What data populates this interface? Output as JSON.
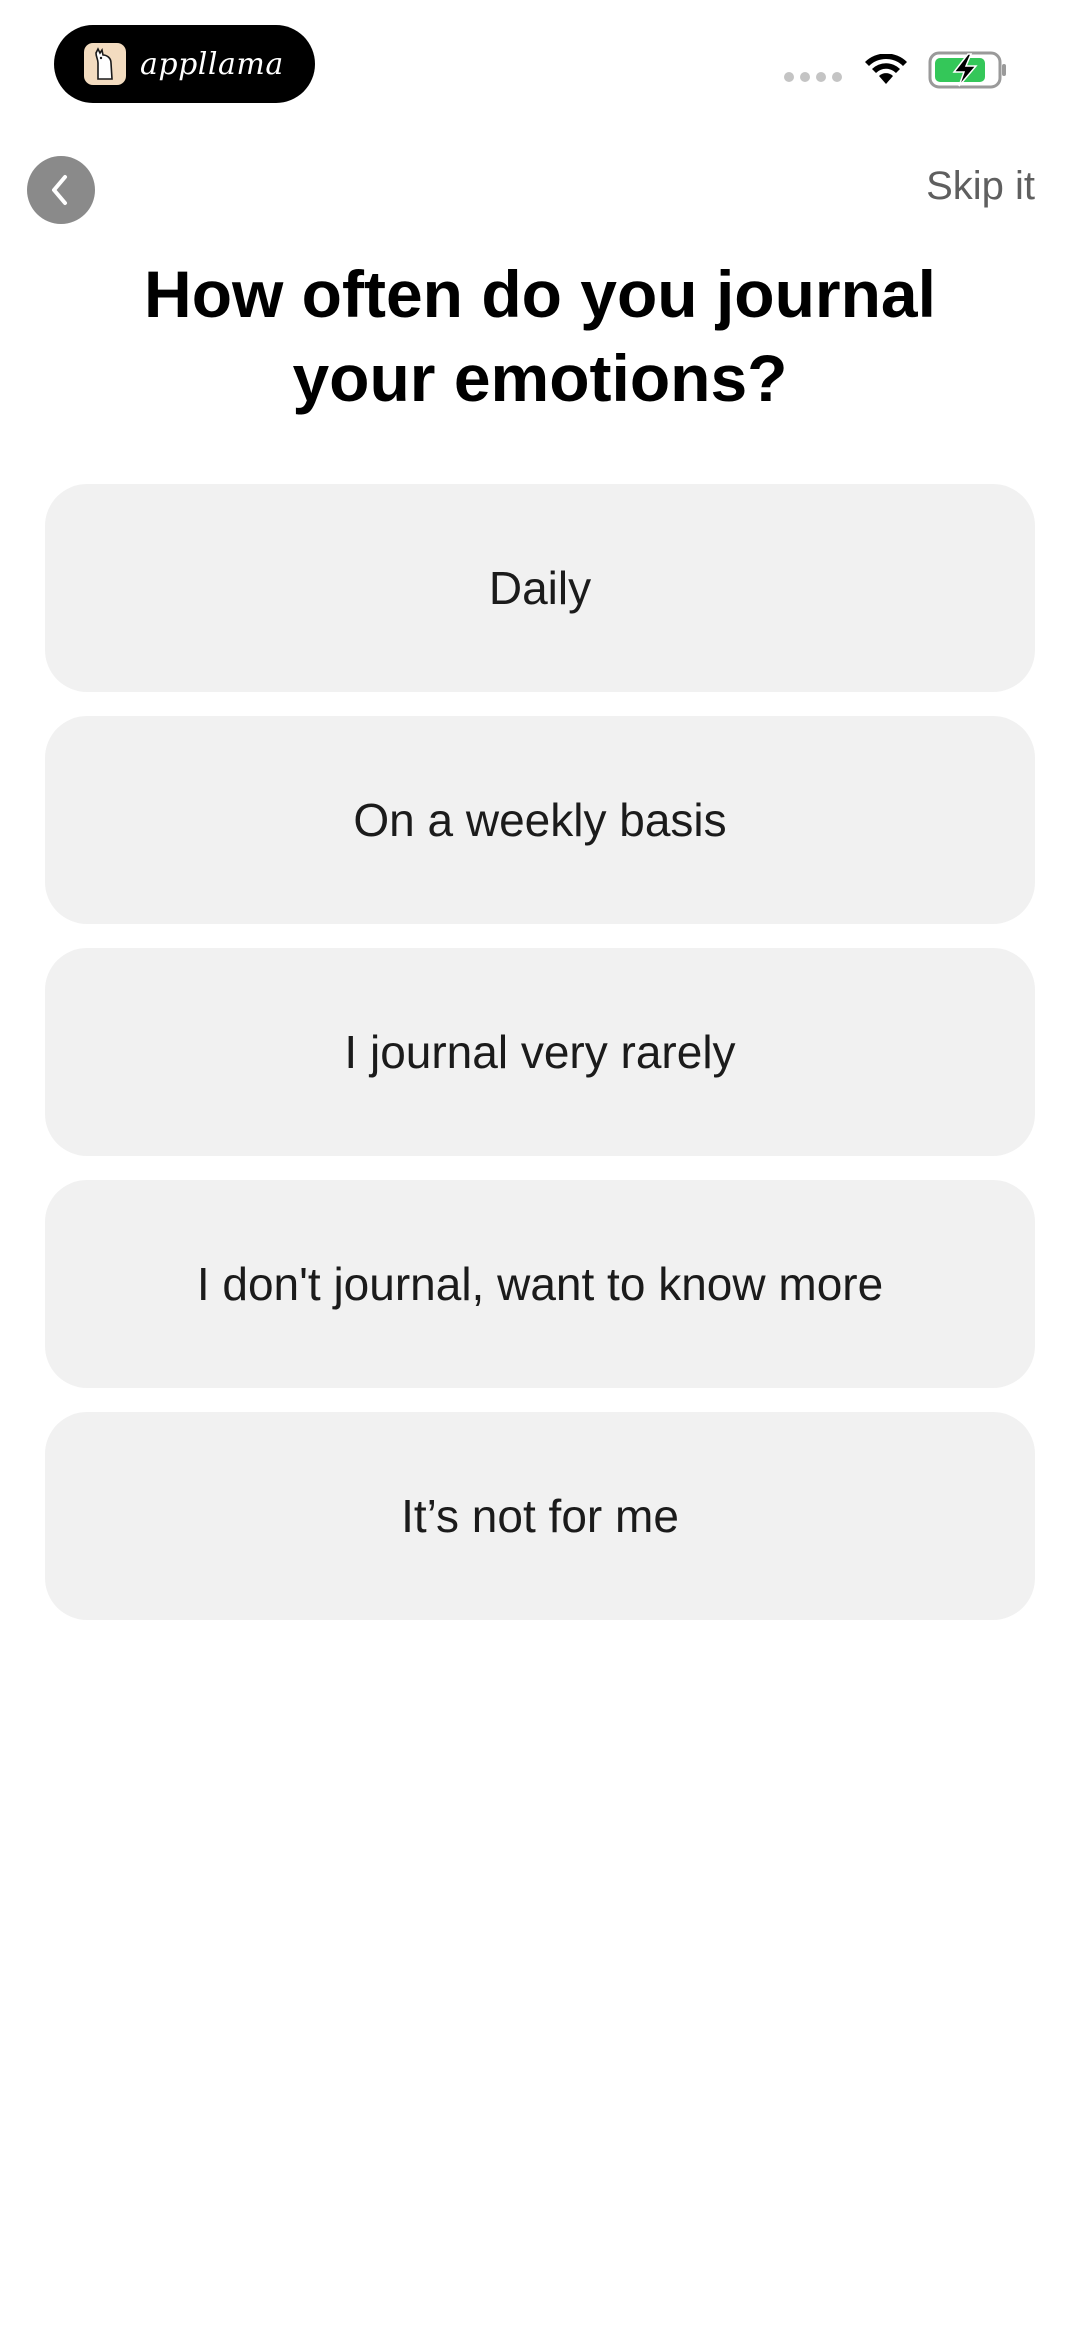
{
  "status_bar": {
    "brand_name": "appllama",
    "battery_color": "#34c759"
  },
  "nav": {
    "back_icon": "chevron-left-icon",
    "skip_label": "Skip it"
  },
  "question": {
    "line1": "How often do you journal",
    "line2": "your emotions?"
  },
  "options": [
    {
      "label": "Daily"
    },
    {
      "label": "On a weekly basis"
    },
    {
      "label": "I journal very rarely"
    },
    {
      "label": "I don't journal, want to know more"
    },
    {
      "label": "It’s not for me"
    }
  ]
}
